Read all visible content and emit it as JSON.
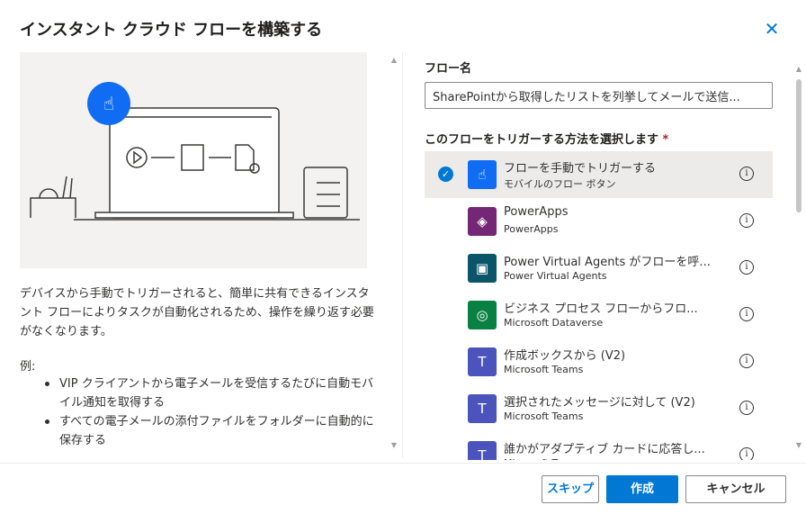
{
  "dialog": {
    "title": "インスタント クラウド フローを構築する"
  },
  "left": {
    "description": "デバイスから手動でトリガーされると、簡単に共有できるインスタント フローによりタスクが自動化されるため、操作を繰り返す必要がなくなります。",
    "examples_label": "例:",
    "examples": [
      "VIP クライアントから電子メールを受信するたびに自動モバイル通知を取得する",
      "すべての電子メールの添付ファイルをフォルダーに自動的に保存する"
    ]
  },
  "form": {
    "flow_name_label": "フロー名",
    "flow_name_value": "SharePointから取得したリストを列挙してメールで送信...",
    "trigger_label": "このフローをトリガーする方法を選択します",
    "required_mark": "*"
  },
  "triggers": [
    {
      "title": "フローを手動でトリガーする",
      "source": "モバイルのフロー ボタン",
      "color": "#0f6cf3",
      "icon": "hand-touch-icon",
      "selected": true
    },
    {
      "title": "PowerApps",
      "source": "PowerApps",
      "color": "#742774",
      "icon": "powerapps-icon"
    },
    {
      "title": "Power Virtual Agents がフローを呼...",
      "source": "Power Virtual Agents",
      "color": "#0b556a",
      "icon": "chat-bubbles-icon"
    },
    {
      "title": "ビジネス プロセス フローからフロ...",
      "source": "Microsoft Dataverse",
      "color": "#088142",
      "icon": "dataverse-icon"
    },
    {
      "title": "作成ボックスから (V2)",
      "source": "Microsoft Teams",
      "color": "#4b53bc",
      "icon": "teams-icon"
    },
    {
      "title": "選択されたメッセージに対して (V2)",
      "source": "Microsoft Teams",
      "color": "#4b53bc",
      "icon": "teams-icon"
    },
    {
      "title": "誰かがアダプティブ カードに応答し...",
      "source": "Microsoft Teams",
      "color": "#4b53bc",
      "icon": "teams-icon"
    }
  ],
  "footer": {
    "skip": "スキップ",
    "create": "作成",
    "cancel": "キャンセル"
  }
}
